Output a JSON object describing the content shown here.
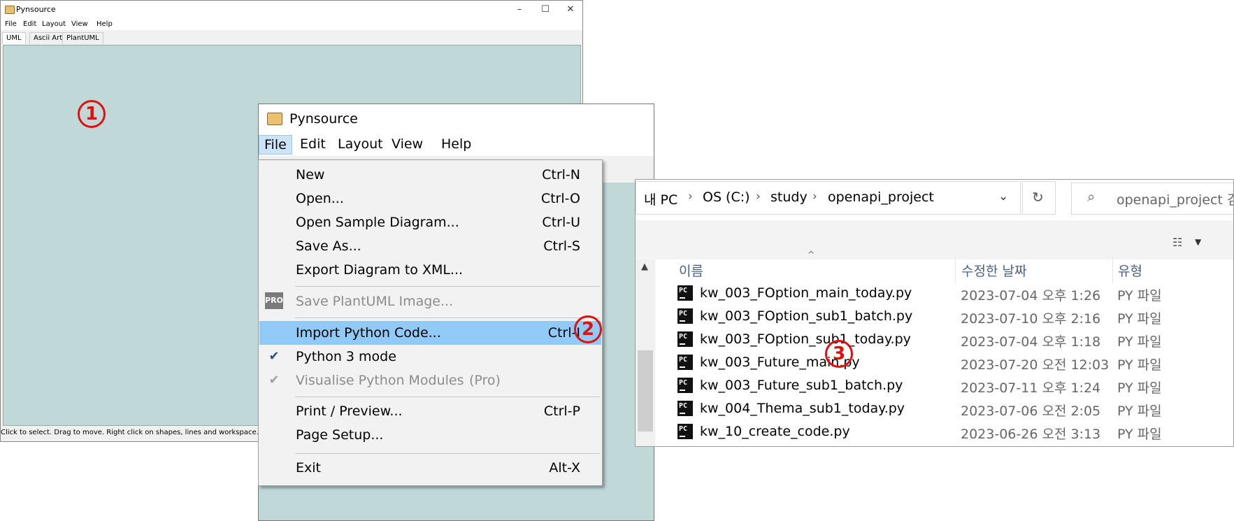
{
  "back_window": {
    "title": "Pynsource",
    "controls": [
      "–",
      "☐",
      "✕"
    ],
    "menu": [
      "File",
      "Edit",
      "Layout",
      "View",
      "Help"
    ],
    "tabs": [
      "UML",
      "Ascii Art",
      "PlantUML"
    ],
    "status": "Click to select.  Drag to move.  Right click on shapes, lines and workspace.  CMD/"
  },
  "front_window": {
    "title": "Pynsource",
    "menu": [
      "File",
      "Edit",
      "Layout",
      "View",
      "Help"
    ],
    "open_menu": "File"
  },
  "file_menu": {
    "items": [
      {
        "label": "New",
        "shortcut": "Ctrl-N"
      },
      {
        "label": "Open...",
        "shortcut": "Ctrl-O"
      },
      {
        "label": "Open Sample Diagram...",
        "shortcut": "Ctrl-U"
      },
      {
        "label": "Save As...",
        "shortcut": "Ctrl-S"
      },
      {
        "label": "Export Diagram to XML...",
        "shortcut": ""
      },
      {
        "label": "Save PlantUML Image...",
        "shortcut": "",
        "badge": "PRO"
      },
      {
        "label": "Import Python Code...",
        "shortcut": "Ctrl-I"
      },
      {
        "label": "Python 3 mode",
        "shortcut": ""
      },
      {
        "label": "Visualise Python Modules",
        "shortcut": "(Pro)"
      },
      {
        "label": "Print / Preview...",
        "shortcut": "Ctrl-P"
      },
      {
        "label": "Page Setup...",
        "shortcut": ""
      },
      {
        "label": "Exit",
        "shortcut": "Alt-X"
      }
    ]
  },
  "explorer": {
    "breadcrumb": [
      "내 PC",
      "OS (C:)",
      "study",
      "openapi_project"
    ],
    "search_placeholder": "openapi_project 검색",
    "columns": [
      "이름",
      "수정한 날짜",
      "유형"
    ],
    "files": [
      {
        "name": "kw_003_FOption_main_today.py",
        "date": "2023-07-04 오후 1:26",
        "type": "PY 파일"
      },
      {
        "name": "kw_003_FOption_sub1_batch.py",
        "date": "2023-07-10 오후 2:16",
        "type": "PY 파일"
      },
      {
        "name": "kw_003_FOption_sub1_today.py",
        "date": "2023-07-04 오후 1:18",
        "type": "PY 파일"
      },
      {
        "name": "kw_003_Future_main.py",
        "date": "2023-07-20 오전 12:03",
        "type": "PY 파일"
      },
      {
        "name": "kw_003_Future_sub1_batch.py",
        "date": "2023-07-11 오후 1:24",
        "type": "PY 파일"
      },
      {
        "name": "kw_004_Thema_sub1_today.py",
        "date": "2023-07-06 오전 2:05",
        "type": "PY 파일"
      },
      {
        "name": "kw_10_create_code.py",
        "date": "2023-06-26 오전 3:13",
        "type": "PY 파일"
      }
    ]
  },
  "markers": [
    "1",
    "2",
    "3"
  ],
  "colors": {
    "canvas": "#bfd9d8",
    "highlight": "#91c9f7",
    "marker": "#e01010"
  }
}
